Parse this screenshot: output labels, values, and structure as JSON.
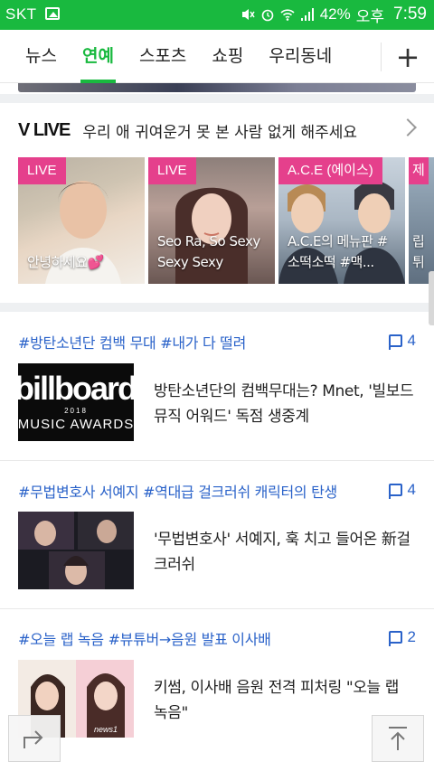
{
  "status_bar": {
    "carrier": "SKT",
    "battery": "42%",
    "ampm": "오후",
    "time": "7:59"
  },
  "tabs": [
    {
      "label": "뉴스",
      "active": false
    },
    {
      "label": "연예",
      "active": true
    },
    {
      "label": "스포츠",
      "active": false
    },
    {
      "label": "쇼핑",
      "active": false
    },
    {
      "label": "우리동네",
      "active": false
    }
  ],
  "vlive": {
    "logo": "V LIVE",
    "title": "우리 애 귀여운거 못 본 사람 없게 해주세요",
    "cards": [
      {
        "badge": "LIVE",
        "caption": "안녕하세요💕"
      },
      {
        "badge": "LIVE",
        "caption": "Seo Ra, So Sexy Sexy Sexy"
      },
      {
        "badge": "A.C.E (에이스)",
        "caption": "A.C.E의 메뉴판 # 소떡소떡 #맥..."
      },
      {
        "badge": "제",
        "caption": "립 튀"
      }
    ]
  },
  "news": [
    {
      "tags": "#방탄소년단 컴백 무대 #내가 다 떨려",
      "comments": "4",
      "title": "방탄소년단의 컴백무대는? Mnet, '빌보드 뮤직 어워드' 독점 생중계",
      "thumb_text": {
        "line1": "billboard",
        "line2": "2018",
        "line3": "MUSIC AWARDS"
      }
    },
    {
      "tags": "#무법변호사 서예지 #역대급 걸크러쉬 캐릭터의 탄생",
      "comments": "4",
      "title": "'무법변호사' 서예지, 훅 치고 들어온 新걸크러쉬"
    },
    {
      "tags": "#오늘 랩 녹음 #뷰튜버→음원 발표 이사배",
      "comments": "2",
      "title": "키썸, 이사배 음원 전격 피처링 \"오늘 랩 녹음\"",
      "thumb_text": {
        "watermark": "news1"
      }
    }
  ],
  "colors": {
    "brand_green": "#19b93f",
    "live_pink": "#e5408c",
    "link_blue": "#2a62c9"
  },
  "icons": {
    "add_tab": "plus-icon",
    "vlive_more": "chevron-right-icon",
    "share": "share-icon",
    "scroll_top": "arrow-up-icon"
  }
}
